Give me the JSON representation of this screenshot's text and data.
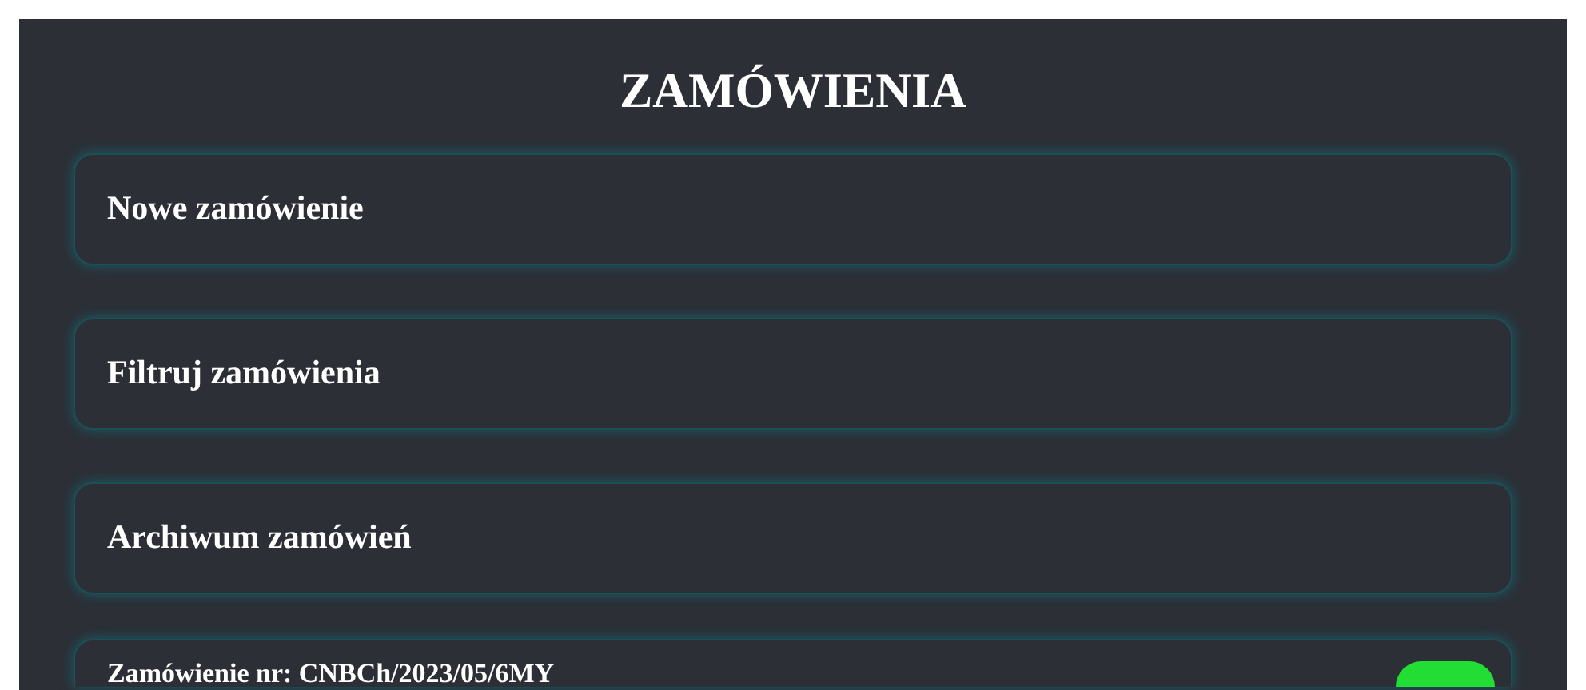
{
  "title": "ZAMÓWIENIA",
  "menu": [
    {
      "label": "Nowe zamówienie"
    },
    {
      "label": "Filtruj zamówienia"
    },
    {
      "label": "Archiwum zamówień"
    }
  ],
  "order": {
    "label": "Zamówienie nr: CNBCh/2023/05/6MY"
  }
}
